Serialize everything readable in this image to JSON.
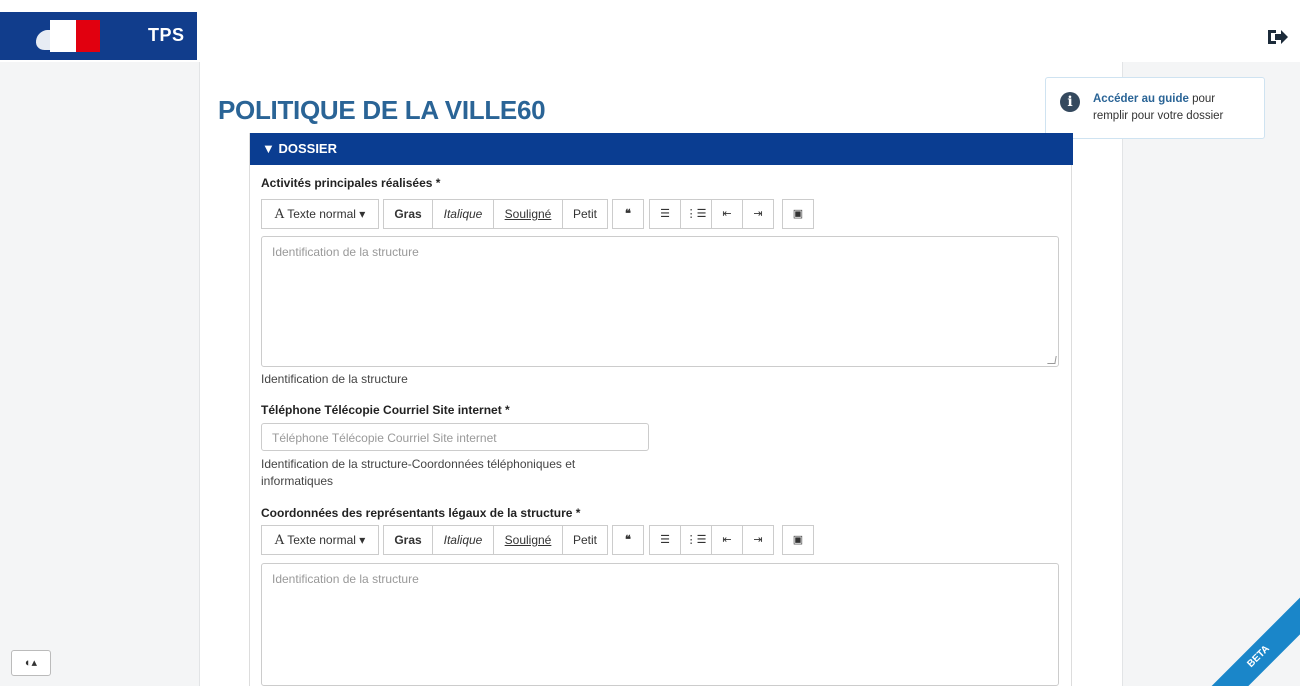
{
  "header": {
    "brand": "TPS"
  },
  "page": {
    "title": "POLITIQUE DE LA VILLE60"
  },
  "guide": {
    "link": "Accéder au guide",
    "text_after_link": " pour remplir pour votre dossier"
  },
  "panel": {
    "heading": "▼ DOSSIER"
  },
  "toolbar": {
    "style_select": "Texte normal",
    "bold": "Gras",
    "italic": "Italique",
    "underline": "Souligné",
    "small": "Petit"
  },
  "fields": {
    "activites": {
      "label": "Activités principales réalisées *",
      "placeholder": "Identification de la structure",
      "help": "Identification de la structure"
    },
    "telephone": {
      "label": "Téléphone Télécopie Courriel Site internet *",
      "placeholder": "Téléphone Télécopie Courriel Site internet",
      "help": "Identification de la structure-Coordonnées téléphoniques et informatiques"
    },
    "representants": {
      "label": "Coordonnées des représentants légaux de la structure *",
      "placeholder": "Identification de la structure"
    }
  },
  "footer": {
    "beta": "BETA"
  },
  "colors": {
    "brand_blue": "#113d8c",
    "panel_blue": "#0a3d91",
    "title_blue": "#2a6496",
    "flag_red": "#e1000f",
    "beta_blue": "#1a86c9"
  }
}
